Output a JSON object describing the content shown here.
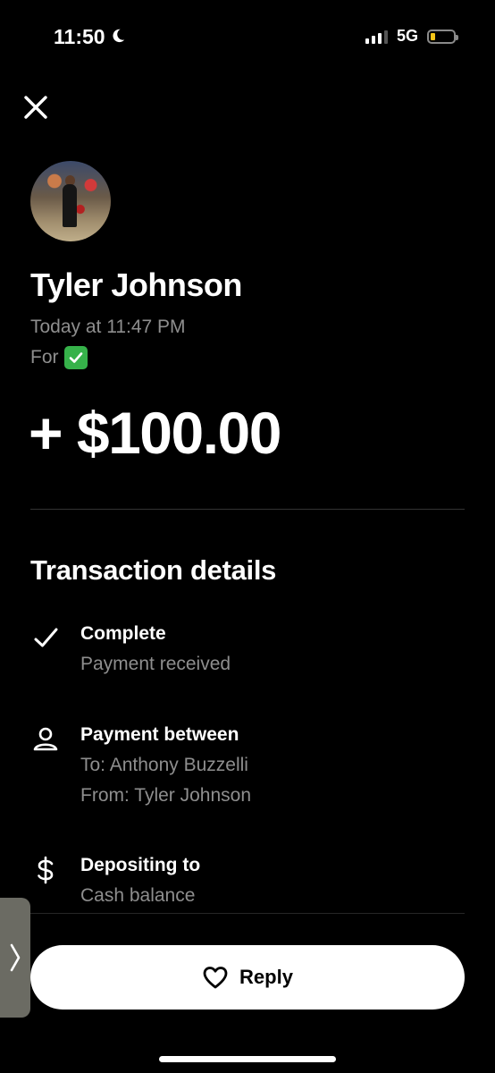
{
  "status_bar": {
    "time": "11:50",
    "network": "5G"
  },
  "header": {
    "close_icon": "close-icon"
  },
  "payment": {
    "name": "Tyler Johnson",
    "timestamp": "Today at 11:47 PM",
    "for_label": "For",
    "for_emoji": "white-heavy-check-mark",
    "amount": "+ $100.00"
  },
  "transaction_details": {
    "title": "Transaction details",
    "items": [
      {
        "icon": "checkmark-icon",
        "title": "Complete",
        "lines": [
          "Payment received"
        ]
      },
      {
        "icon": "person-icon",
        "title": "Payment between",
        "lines": [
          "To: Anthony Buzzelli",
          "From: Tyler Johnson"
        ]
      },
      {
        "icon": "dollar-icon",
        "title": "Depositing to",
        "lines": [
          "Cash balance"
        ]
      }
    ]
  },
  "actions": {
    "reply_label": "Reply",
    "reply_icon": "heart-icon"
  },
  "colors": {
    "background": "#000000",
    "secondary_text": "#8e8e8e",
    "button_bg": "#ffffff",
    "battery_low": "#f5c518",
    "check_emoji_green": "#36b24a"
  }
}
